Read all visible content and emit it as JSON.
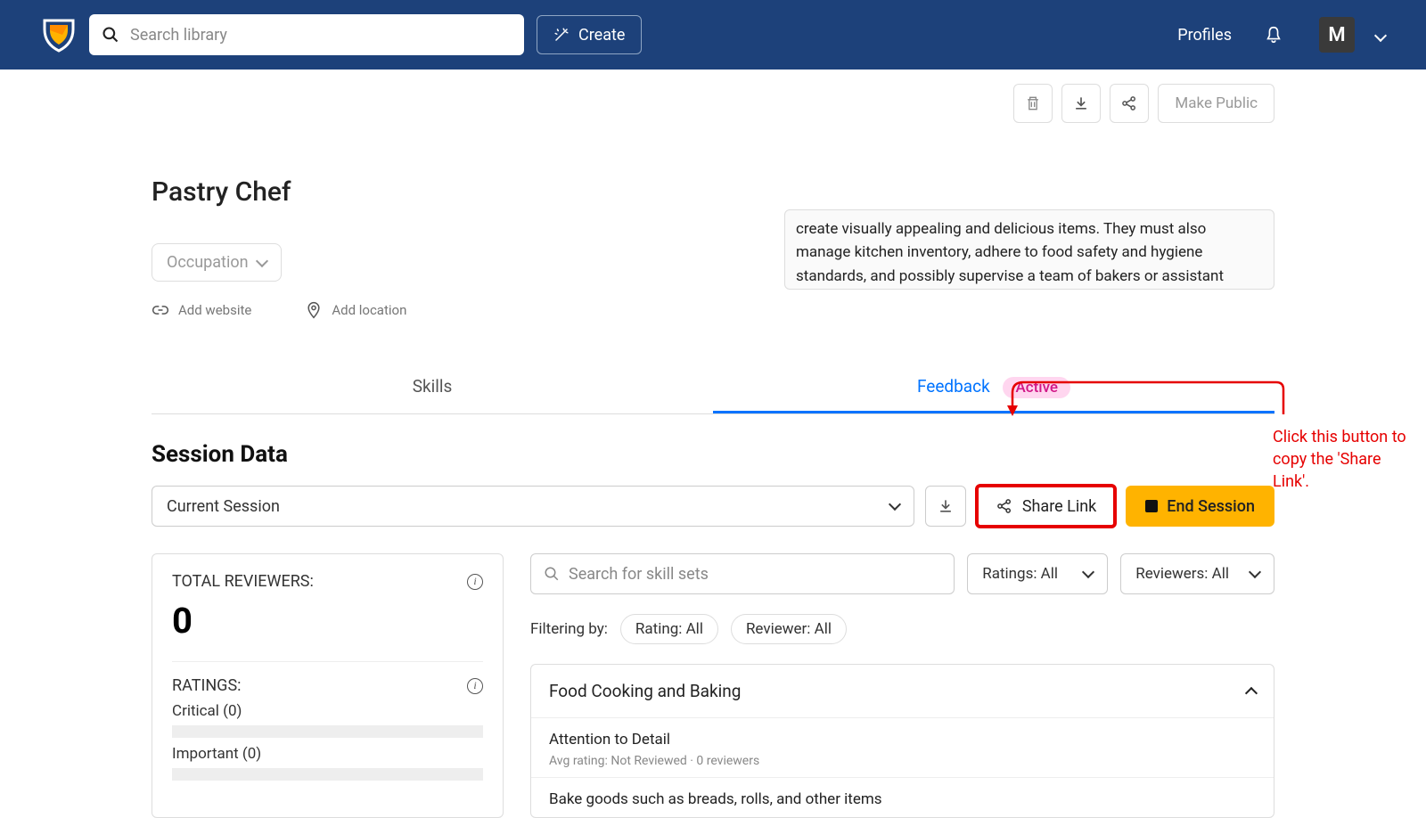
{
  "topbar": {
    "search_placeholder": "Search library",
    "create_label": "Create",
    "profiles_label": "Profiles",
    "avatar_initial": "M"
  },
  "actions": {
    "make_public_label": "Make Public"
  },
  "page": {
    "title": "Pastry Chef",
    "occupation_label": "Occupation",
    "add_website_label": "Add website",
    "add_location_label": "Add location",
    "description": "create visually appealing and delicious items. They must also manage kitchen inventory, adhere to food safety and hygiene standards, and possibly supervise a team of bakers or assistant pastry chefs."
  },
  "tabs": {
    "skills_label": "Skills",
    "feedback_label": "Feedback",
    "active_badge": "Active"
  },
  "session": {
    "heading": "Session Data",
    "selector_label": "Current Session",
    "share_label": "Share Link",
    "end_label": "End Session"
  },
  "reviewers": {
    "total_label": "TOTAL REVIEWERS:",
    "total_value": "0",
    "ratings_label": "RATINGS:",
    "critical_label": "Critical (0)",
    "important_label": "Important (0)"
  },
  "filters": {
    "skill_search_placeholder": "Search for skill sets",
    "ratings_label": "Ratings: All",
    "reviewers_label": "Reviewers: All",
    "filtering_by_label": "Filtering by:",
    "pill_rating": "Rating: All",
    "pill_reviewer": "Reviewer: All"
  },
  "skillset": {
    "group_title": "Food Cooking and Baking",
    "item1_title": "Attention to Detail",
    "item1_meta": "Avg rating: Not Reviewed   ·   0 reviewers",
    "item2_title": "Bake goods such as breads, rolls, and other items"
  },
  "annotation": {
    "text": "Click this button to copy the 'Share Link'."
  }
}
